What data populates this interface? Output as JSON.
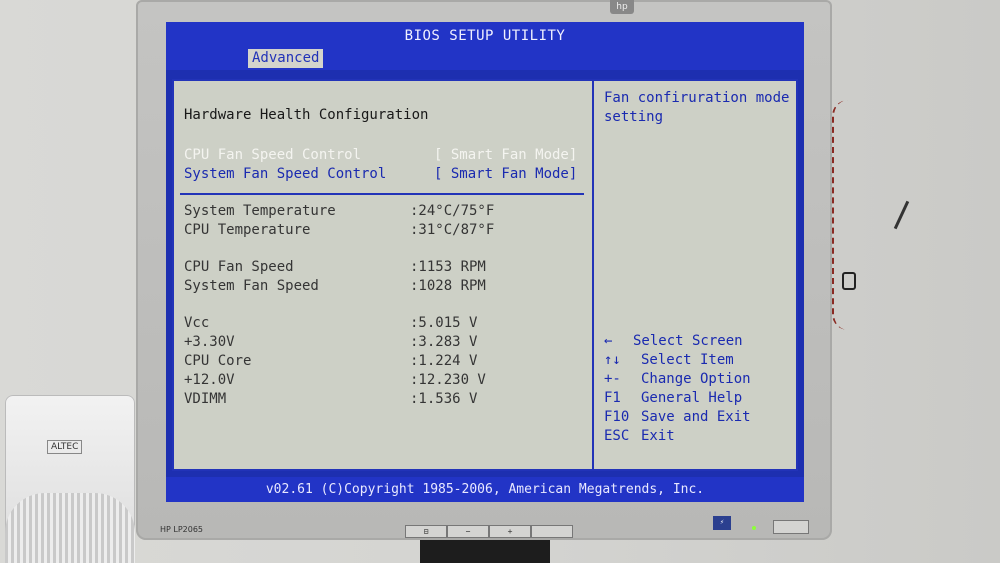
{
  "monitor": {
    "brand_logo": "hp",
    "model_label": "HP LP2065",
    "buttons": [
      "⊟",
      "−",
      "+",
      ""
    ],
    "power_led_color": "#8cff3a"
  },
  "speaker": {
    "logo": "ALTEC"
  },
  "bios": {
    "title": "BIOS SETUP UTILITY",
    "active_tab": "Advanced",
    "heading": "Hardware Health Configuration",
    "fan_controls": [
      {
        "label": "CPU Fan Speed Control",
        "value": "[ Smart Fan Mode]",
        "state": "selected"
      },
      {
        "label": "System Fan Speed Control",
        "value": "[ Smart Fan Mode]",
        "state": "normal"
      }
    ],
    "temperatures": [
      {
        "label": "System Temperature",
        "value": ":24°C/75°F"
      },
      {
        "label": "CPU Temperature",
        "value": ":31°C/87°F"
      }
    ],
    "fan_speeds": [
      {
        "label": "CPU Fan Speed",
        "value": ":1153 RPM"
      },
      {
        "label": "System Fan Speed",
        "value": ":1028 RPM"
      }
    ],
    "voltages": [
      {
        "label": "Vcc",
        "value": ":5.015 V"
      },
      {
        "label": "+3.30V",
        "value": ":3.283 V"
      },
      {
        "label": "CPU Core",
        "value": ":1.224 V"
      },
      {
        "label": "+12.0V",
        "value": ":12.230 V"
      },
      {
        "label": "VDIMM",
        "value": ":1.536 V"
      }
    ],
    "help_text": "Fan confiruration mode setting",
    "key_help": [
      {
        "key": "←",
        "action": "Select Screen"
      },
      {
        "key": "↑↓",
        "action": "Select Item"
      },
      {
        "key": "+-",
        "action": "Change Option"
      },
      {
        "key": "F1",
        "action": "General Help"
      },
      {
        "key": "F10",
        "action": "Save and Exit"
      },
      {
        "key": "ESC",
        "action": "Exit"
      }
    ],
    "footer": "v02.61 (C)Copyright 1985-2006, American Megatrends, Inc.",
    "colors": {
      "screen_blue": "#2234c6",
      "panel_gray": "#cdd0c6",
      "text_blue": "#1a2ab0",
      "highlight_white": "#f4f4f0"
    }
  }
}
